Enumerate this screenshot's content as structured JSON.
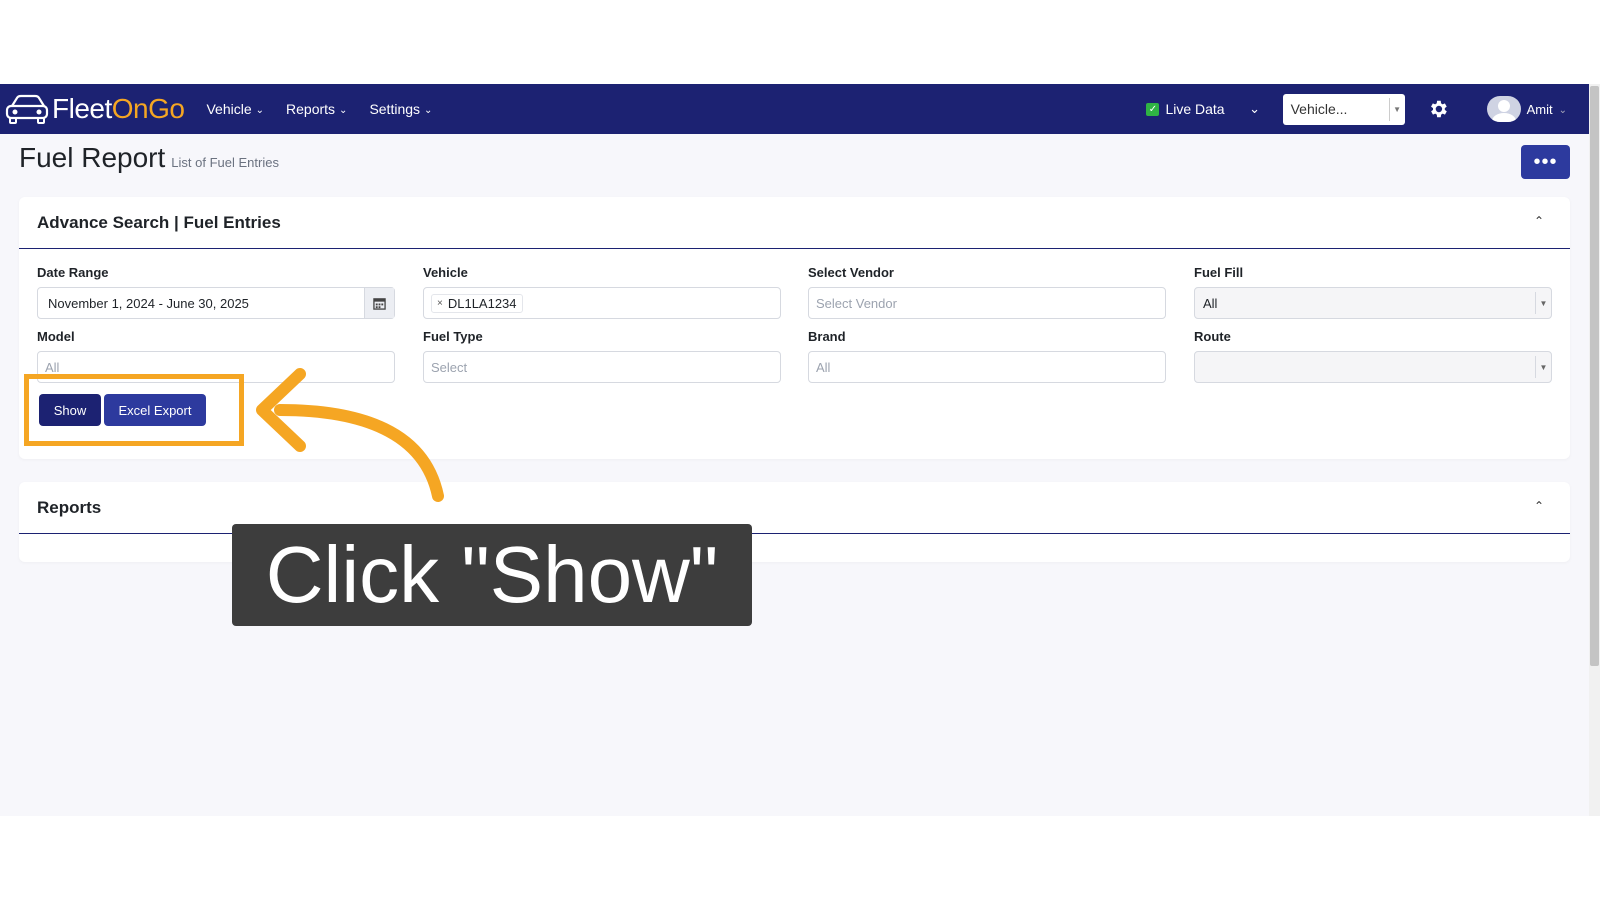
{
  "navbar": {
    "logo_part1": "Fleet",
    "logo_part2": "On",
    "logo_part3": "Go",
    "menu": [
      {
        "label": "Vehicle"
      },
      {
        "label": "Reports"
      },
      {
        "label": "Settings"
      }
    ],
    "live_data_label": "Live Data",
    "vehicle_select_value": "Vehicle...",
    "user_name": "Amit",
    "bg_color": "#1c2272"
  },
  "page": {
    "title": "Fuel Report",
    "subtitle": "List of Fuel Entries",
    "more_button": "•••"
  },
  "search_card": {
    "title": "Advance Search | Fuel Entries",
    "fields": {
      "date_range": {
        "label": "Date Range",
        "value": "November 1, 2024 - June 30, 2025"
      },
      "vehicle": {
        "label": "Vehicle",
        "tag": "DL1LA1234"
      },
      "vendor": {
        "label": "Select Vendor",
        "placeholder": "Select Vendor"
      },
      "fuel_fill": {
        "label": "Fuel Fill",
        "value": "All"
      },
      "model": {
        "label": "Model",
        "placeholder": "All"
      },
      "fuel_type": {
        "label": "Fuel Type",
        "placeholder": "Select"
      },
      "brand": {
        "label": "Brand",
        "placeholder": "All"
      },
      "route": {
        "label": "Route",
        "value": ""
      }
    },
    "show_button": "Show",
    "excel_button": "Excel Export"
  },
  "reports_card": {
    "title": "Reports"
  },
  "annotation": {
    "callout_text": "Click \"Show\"",
    "highlight_color": "#f5a623"
  }
}
